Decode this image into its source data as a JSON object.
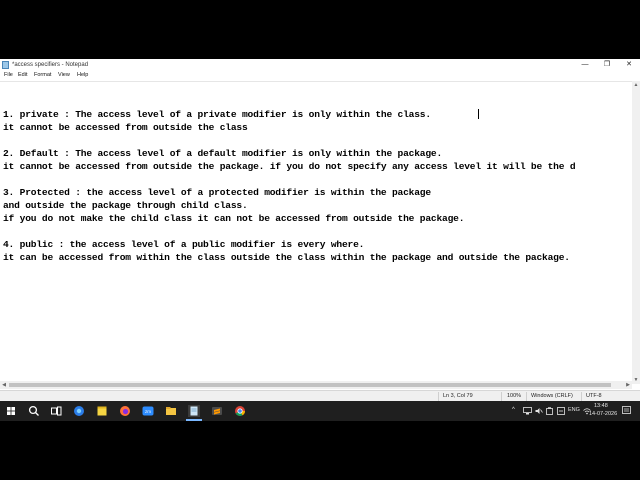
{
  "window": {
    "title": "*access specifiers - Notepad",
    "minimize_glyph": "—",
    "maximize_glyph": "❐",
    "close_glyph": "✕"
  },
  "menu": [
    "File",
    "Edit",
    "Format",
    "View",
    "Help"
  ],
  "editor": {
    "lines": [
      "1. private : The access level of a private modifier is only within the class.",
      "it cannot be accessed from outside the class",
      "2. Default : The access level of a default modifier is only within the package.",
      "it cannot be accessed from outside the package. if you do not specify any access level it will be the d",
      "3. Protected : the access level of a protected modifier is within the package",
      "and outside the package through child class.",
      "if you do not make the child class it can not be accessed from outside the package.",
      "4. public : the access level of a public modifier is every where.",
      "it can be accessed from within the class outside the class within the package and outside the package."
    ]
  },
  "statusbar": {
    "position": "Ln 3, Col 79",
    "zoom": "100%",
    "line_ending": "Windows (CRLF)",
    "encoding": "UTF-8"
  },
  "taskbar": {
    "apps": [
      "windows-start",
      "search",
      "task-view",
      "chrome-like",
      "sticky-notes",
      "firefox",
      "zoom",
      "file-explorer",
      "notepad",
      "sublime",
      "chrome"
    ],
    "zoom_label": "zm",
    "tray": {
      "chevron": "^",
      "language": "ENG",
      "time": "13:48",
      "date": "14-07-2026"
    }
  },
  "colors": {
    "taskbar_bg": "#1f1f1f",
    "statusbar_bg": "#f0f0f0",
    "editor_bg": "#ffffff"
  }
}
